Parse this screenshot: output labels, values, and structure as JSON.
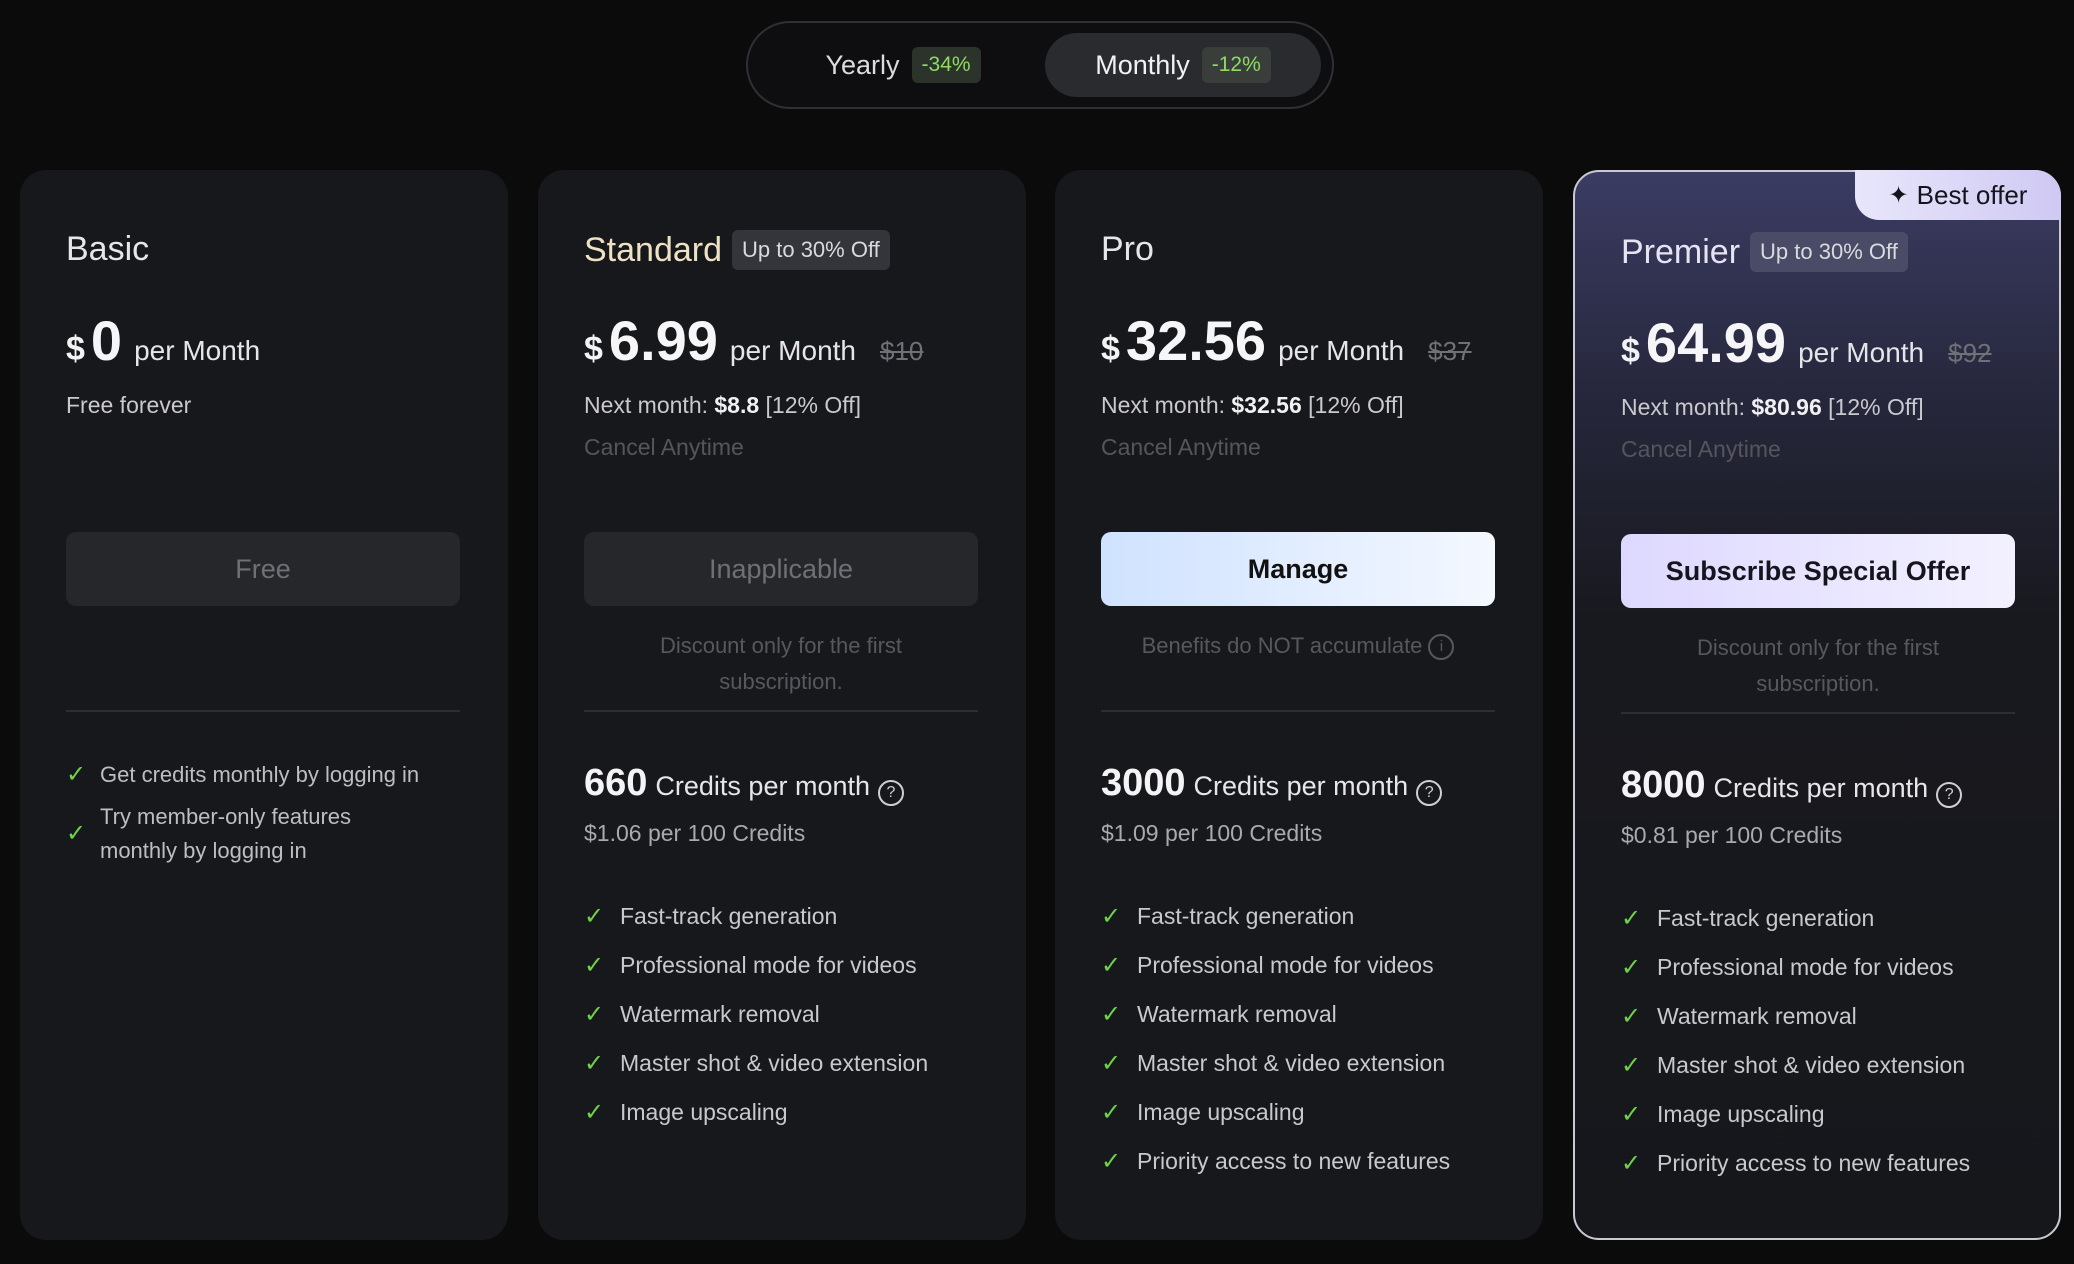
{
  "toggle": {
    "yearly": {
      "label": "Yearly",
      "badge": "-34%"
    },
    "monthly": {
      "label": "Monthly",
      "badge": "-12%"
    }
  },
  "plans": {
    "basic": {
      "name": "Basic",
      "currency": "$",
      "amount": "0",
      "per": "per Month",
      "note": "Free forever",
      "button": "Free",
      "features": [
        "Get credits monthly by logging in",
        "Try member-only features monthly by logging in"
      ]
    },
    "standard": {
      "name": "Standard",
      "badge": "Up to 30% Off",
      "currency": "$",
      "amount": "6.99",
      "per": "per Month",
      "original": "$10",
      "next_label": "Next month: ",
      "next_price": "$8.8",
      "next_off": " [12% Off]",
      "cancel": "Cancel Anytime",
      "button": "Inapplicable",
      "note": "Discount only for the first subscription.",
      "credits": "660",
      "credits_text": "Credits per month",
      "per_credits": "$1.06 per 100 Credits",
      "features": [
        "Fast-track generation",
        "Professional mode for videos",
        "Watermark removal",
        "Master shot & video extension",
        "Image upscaling"
      ]
    },
    "pro": {
      "name": "Pro",
      "currency": "$",
      "amount": "32.56",
      "per": "per Month",
      "original": "$37",
      "next_label": "Next month: ",
      "next_price": "$32.56",
      "next_off": " [12% Off]",
      "cancel": "Cancel Anytime",
      "button": "Manage",
      "note": "Benefits do NOT accumulate",
      "credits": "3000",
      "credits_text": "Credits per month",
      "per_credits": "$1.09 per 100 Credits",
      "features": [
        "Fast-track generation",
        "Professional mode for videos",
        "Watermark removal",
        "Master shot & video extension",
        "Image upscaling",
        "Priority access to new features"
      ]
    },
    "premier": {
      "name": "Premier",
      "badge": "Up to 30% Off",
      "corner": "Best offer",
      "currency": "$",
      "amount": "64.99",
      "per": "per Month",
      "original": "$92",
      "next_label": "Next month: ",
      "next_price": "$80.96",
      "next_off": " [12% Off]",
      "cancel": "Cancel Anytime",
      "button": "Subscribe Special Offer",
      "note": "Discount only for the first subscription.",
      "credits": "8000",
      "credits_text": "Credits per month",
      "per_credits": "$0.81 per 100 Credits",
      "features": [
        "Fast-track generation",
        "Professional mode for videos",
        "Watermark removal",
        "Master shot & video extension",
        "Image upscaling",
        "Priority access to new features"
      ]
    }
  },
  "icons": {
    "check": "check-icon",
    "help": "question-circle-icon",
    "info": "info-circle-icon",
    "sparkle": "sparkle-icon"
  },
  "colors": {
    "accent_green": "#6fd24a",
    "background": "#0b0b0c",
    "card": "#17181b"
  }
}
